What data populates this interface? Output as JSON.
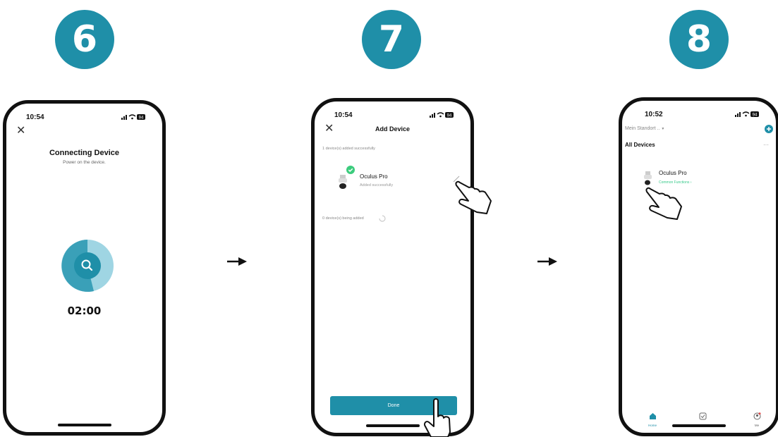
{
  "colors": {
    "accent": "#1f8fa8",
    "ring": "#9fd5e3",
    "success": "#3ccc7d",
    "link": "#37c98a"
  },
  "steps": [
    "6",
    "7",
    "8"
  ],
  "screen6": {
    "time": "10:54",
    "battery": "94",
    "title": "Connecting Device",
    "subtitle": "Power on the device.",
    "timer": "02:00"
  },
  "screen7": {
    "time": "10:54",
    "battery": "94",
    "title": "Add Device",
    "added_label": "1 device(s) added successfully",
    "device_name": "Oculus Pro",
    "device_status": "Added successfully",
    "adding_label": "0 device(s) being added",
    "done_label": "Done"
  },
  "screen8": {
    "time": "10:52",
    "battery": "94",
    "location": "Mein Standort ..",
    "section_title": "All Devices",
    "more": "···",
    "device_name": "Oculus Pro",
    "device_sub": "Common Functions ›",
    "tabs": [
      {
        "label": "Home",
        "icon": "home-icon"
      },
      {
        "label": "Scene",
        "icon": "scene-icon"
      },
      {
        "label": "Me",
        "icon": "profile-icon"
      }
    ]
  }
}
